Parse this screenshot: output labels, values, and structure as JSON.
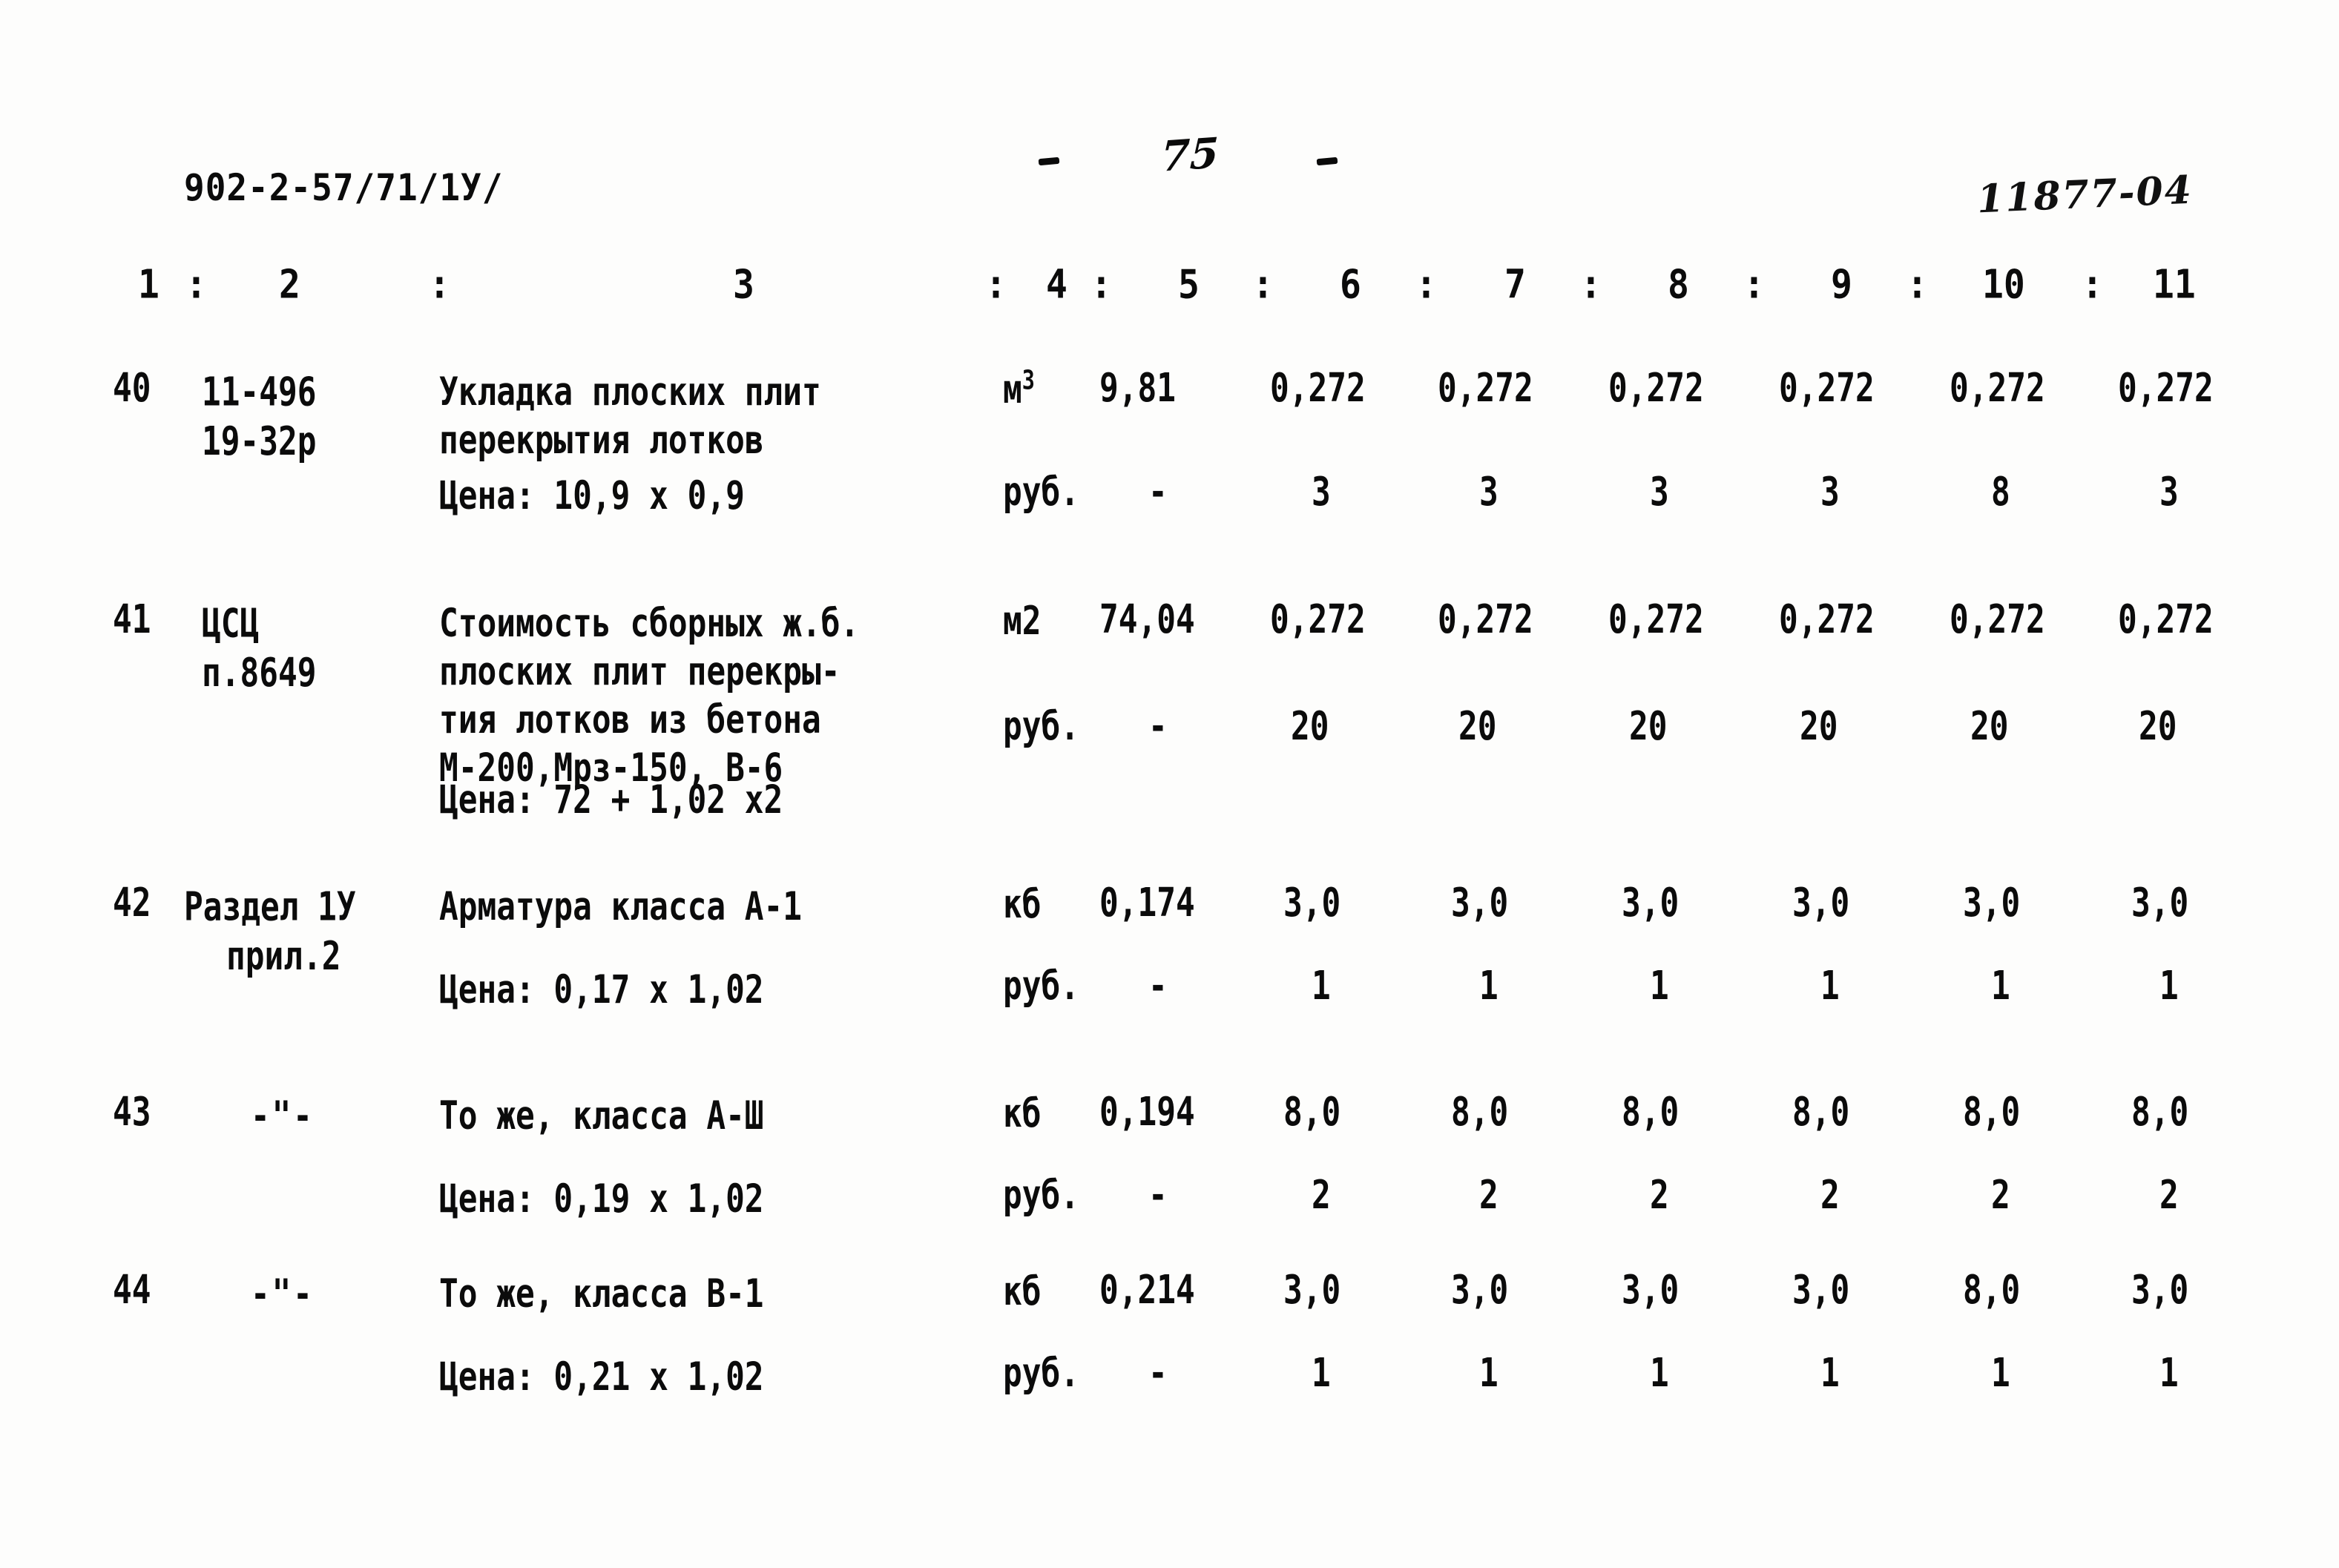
{
  "header": {
    "doc_code": "902-2-57/71/1У/",
    "page_number": "75",
    "stamp_code": "11877-04"
  },
  "column_numbers": [
    "1",
    ":",
    "2",
    ":",
    "3",
    ":",
    "4",
    ":",
    "5",
    ":",
    "6",
    ":",
    "7",
    ":",
    "8",
    ":",
    "9",
    ":",
    "10",
    ":",
    "11"
  ],
  "table": {
    "rows": [
      {
        "index": "40",
        "code_line1": "11-496",
        "code_line2": "19-32р",
        "description": "Укладка плоских плит\nперекрытия лотков",
        "unit": "м",
        "unit_sup": "3",
        "qty": "9,81",
        "values": [
          "0,272",
          "0,272",
          "0,272",
          "0,272",
          "0,272",
          "0,272"
        ],
        "price_label": "Цена: 10,9 x 0,9",
        "price_unit": "руб.",
        "price_qty": "-",
        "price_values": [
          "3",
          "3",
          "3",
          "3",
          "8",
          "3"
        ]
      },
      {
        "index": "41",
        "code_line1": "ЦСЦ",
        "code_line2": "п.8649",
        "description": "Стоимость сборных ж.б.\nплоских плит перекры-\nтия лотков из бетона\nМ-200,Мрз-150, В-6",
        "unit": "м2",
        "unit_sup": "",
        "qty": "74,04",
        "values": [
          "0,272",
          "0,272",
          "0,272",
          "0,272",
          "0,272",
          "0,272"
        ],
        "price_label": "Цена: 72 + 1,02 x2",
        "price_unit": "руб.",
        "price_qty": "-",
        "price_values": [
          "20",
          "20",
          "20",
          "20",
          "20",
          "20"
        ]
      },
      {
        "index": "42",
        "code_line1": "Раздел 1У",
        "code_line2": "прил.2",
        "description": "Арматура класса А-1",
        "unit": "кб",
        "unit_sup": "",
        "qty": "0,174",
        "values": [
          "3,0",
          "3,0",
          "3,0",
          "3,0",
          "3,0",
          "3,0"
        ],
        "price_label": "Цена: 0,17 x 1,02",
        "price_unit": "руб.",
        "price_qty": "-",
        "price_values": [
          "1",
          "1",
          "1",
          "1",
          "1",
          "1"
        ]
      },
      {
        "index": "43",
        "code_line1": "-\"-",
        "code_line2": "",
        "description": "То же, класса А-Ш",
        "unit": "кб",
        "unit_sup": "",
        "qty": "0,194",
        "values": [
          "8,0",
          "8,0",
          "8,0",
          "8,0",
          "8,0",
          "8,0"
        ],
        "price_label": "Цена: 0,19 x 1,02",
        "price_unit": "руб.",
        "price_qty": "-",
        "price_values": [
          "2",
          "2",
          "2",
          "2",
          "2",
          "2"
        ]
      },
      {
        "index": "44",
        "code_line1": "-\"-",
        "code_line2": "",
        "description": "То же, класса В-1",
        "unit": "кб",
        "unit_sup": "",
        "qty": "0,214",
        "values": [
          "3,0",
          "3,0",
          "3,0",
          "3,0",
          "8,0",
          "3,0"
        ],
        "price_label": "Цена: 0,21 x 1,02",
        "price_unit": "руб.",
        "price_qty": "-",
        "price_values": [
          "1",
          "1",
          "1",
          "1",
          "1",
          "1"
        ]
      }
    ]
  }
}
